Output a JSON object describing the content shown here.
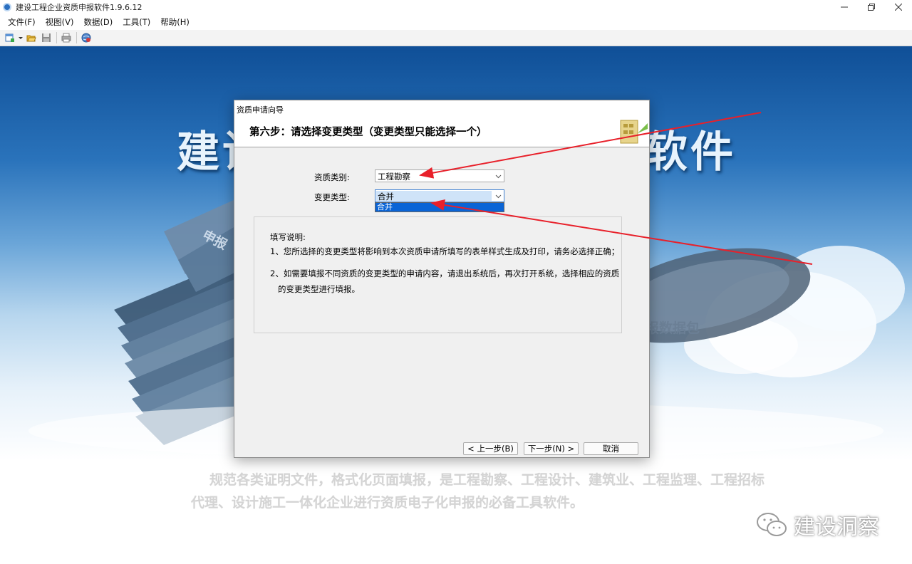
{
  "window": {
    "title": "建设工程企业资质申报软件1.9.6.12"
  },
  "menu": {
    "items": [
      {
        "label": "文件(F)"
      },
      {
        "label": "视图(V)"
      },
      {
        "label": "数据(D)"
      },
      {
        "label": "工具(T)"
      },
      {
        "label": "帮助(H)"
      }
    ]
  },
  "toolbar": {
    "icons": [
      "new-document-icon",
      "dropdown-arrow-icon",
      "open-folder-icon",
      "save-icon",
      "print-icon",
      "web-update-icon"
    ]
  },
  "background": {
    "title_left": "建设",
    "title_right": "软件",
    "pack_label": "报数据包",
    "book_label": "申报",
    "description": "规范各类证明文件，格式化页面填报，是工程勘察、工程设计、建筑业、工程监理、工程招标代理、设计施工一体化企业进行资质电子化申报的必备工具软件。",
    "watermark": "建设洞察"
  },
  "dialog": {
    "title": "资质申请向导",
    "heading": "第六步：请选择变更类型（变更类型只能选择一个）",
    "qualification_label": "资质类别:",
    "qualification_value": "工程勘察",
    "change_type_label": "变更类型:",
    "change_type_value": "合并",
    "dropdown_option": "合并",
    "notes": {
      "title": "填写说明:",
      "line1": "1、您所选择的变更类型将影响到本次资质申请所填写的表单样式生成及打印，请务必选择正确；",
      "line2": "2、如需要填报不同资质的变更类型的申请内容，请退出系统后，再次打开系统，选择相应的资质",
      "line3": "的变更类型进行填报。"
    },
    "buttons": {
      "prev": "< 上一步(B)",
      "next": "下一步(N) >",
      "cancel": "取消"
    }
  },
  "colors": {
    "accent": "#0a64d6",
    "annotation": "#e8202a",
    "bg_blue": "#1c62ac"
  }
}
